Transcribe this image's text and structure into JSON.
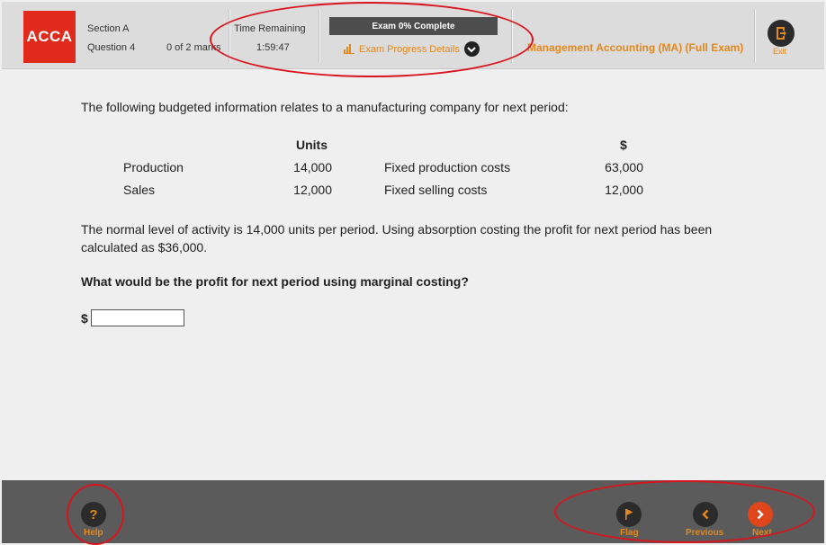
{
  "header": {
    "logo_text": "ACCA",
    "section": "Section A",
    "question": "Question 4",
    "marks": "0 of 2 marks",
    "time_label": "Time Remaining",
    "time_value": "1:59:47",
    "progress_text": "Exam 0% Complete",
    "progress_details": "Exam Progress Details",
    "exam_title": "Management Accounting (MA) (Full Exam)",
    "exit_label": "Exit"
  },
  "content": {
    "intro": "The following budgeted information relates to a manufacturing company for next period:",
    "table": {
      "units_header": "Units",
      "dollar_header": "$",
      "rows": [
        {
          "label": "Production",
          "units": "14,000",
          "cost_label": "Fixed production costs",
          "cost": "63,000"
        },
        {
          "label": "Sales",
          "units": "12,000",
          "cost_label": "Fixed selling costs",
          "cost": "12,000"
        }
      ]
    },
    "paragraph": "The normal level of activity is 14,000 units per period. Using absorption costing the profit for next period has been calculated as $36,000.",
    "question": "What would be the profit for next period using marginal costing?",
    "currency": "$",
    "answer_value": ""
  },
  "footer": {
    "help_label": "Help",
    "flag_label": "Flag",
    "previous_label": "Previous",
    "next_label": "Next"
  },
  "colors": {
    "brand_red": "#e02a1b",
    "accent_orange": "#e2881d",
    "annotation_red": "#d8141d",
    "footer_bg": "#5b5b5b"
  },
  "icons": {
    "exit": "exit-door-icon",
    "progress": "bar-chart-icon",
    "expand": "chevron-down-icon",
    "help": "question-mark-icon",
    "flag": "flag-icon",
    "previous": "chevron-left-icon",
    "next": "chevron-right-icon"
  }
}
